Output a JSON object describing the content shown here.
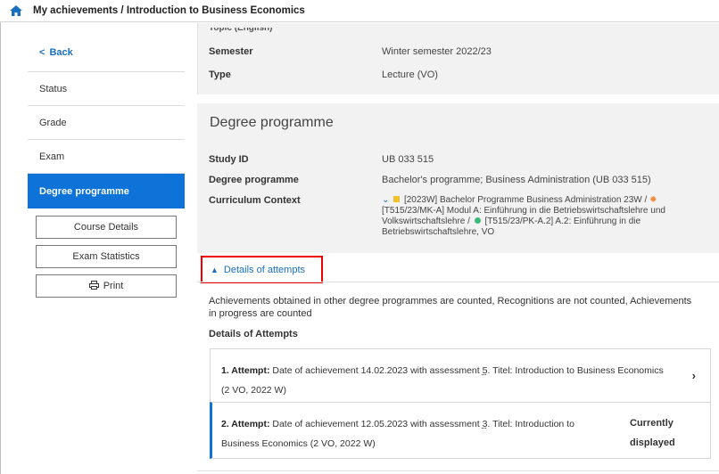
{
  "header": {
    "title": "My achievements / Introduction to Business Economics",
    "icon": "home-icon"
  },
  "sidebar": {
    "back_label": "Back",
    "items": [
      {
        "label": "Status"
      },
      {
        "label": "Grade"
      },
      {
        "label": "Exam"
      },
      {
        "label": "Degree programme",
        "active": true
      }
    ],
    "buttons": {
      "course_details": "Course Details",
      "exam_statistics": "Exam Statistics",
      "print": "Print"
    }
  },
  "course_info": {
    "cropped_label": "Topic (English)",
    "semester_label": "Semester",
    "semester_value": "Winter semester 2022/23",
    "type_label": "Type",
    "type_value": "Lecture (VO)"
  },
  "degree": {
    "title": "Degree programme",
    "study_id_label": "Study ID",
    "study_id_value": "UB 033 515",
    "programme_label": "Degree programme",
    "programme_value": "Bachelor's programme; Business Administration (UB 033 515)",
    "curriculum_label": "Curriculum Context",
    "curriculum_part1": "[2023W] Bachelor Programme Business Administration 23W /",
    "curriculum_part2": "[T515/23/MK-A] Modul A: Einführung in die Betriebswirtschaftslehre und Volkswirtschaftslehre /",
    "curriculum_part3": "[T515/23/PK-A.2] A.2: Einführung in die Betriebswirtschaftslehre, VO"
  },
  "attempts_section": {
    "toggle_label": "Details of attempts",
    "note": "Achievements obtained in other degree programmes are counted, Recognitions are not counted, Achievements in progress are counted",
    "heading": "Details of Attempts",
    "attempts": [
      {
        "num": "1. Attempt:",
        "pre": "Date of achievement 14.02.2023 with assessment ",
        "grade": "5",
        "post": ". Titel: Introduction to Business Economics (2 VO, 2022 W)"
      },
      {
        "num": "2. Attempt:",
        "pre": "Date of achievement 12.05.2023 with assessment ",
        "grade": "3",
        "post": ". Titel: Introduction to Business Economics (2 VO, 2022 W)",
        "status": "Currently displayed"
      }
    ]
  },
  "colors": {
    "accent": "#0d73d8",
    "link": "#1a6fc0",
    "highlight_border": "#ee0000",
    "curriculum_yellow": "#f2c12e",
    "curriculum_orange": "#f08a3a",
    "curriculum_green": "#3db97b"
  }
}
